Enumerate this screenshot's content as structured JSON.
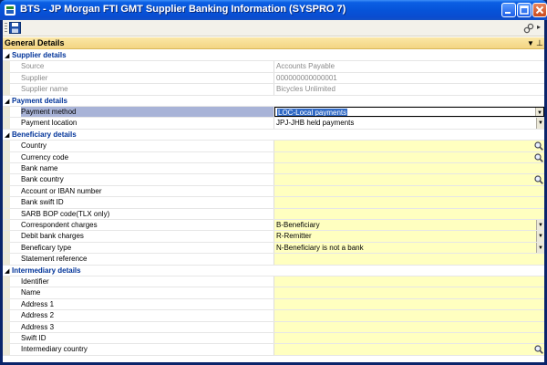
{
  "window": {
    "title": "BTS - JP Morgan FTI GMT Supplier Banking Information (SYSPRO 7)"
  },
  "icons": {
    "app": "app-icon",
    "save": "save-icon",
    "options": "chain-link-icon",
    "lookup": "magnifier-icon"
  },
  "panel": {
    "title": "General Details"
  },
  "groups": {
    "supplier": "Supplier details",
    "payment": "Payment details",
    "beneficiary": "Beneficiary details",
    "intermediary": "Intermediary details"
  },
  "fields": {
    "source": {
      "label": "Source",
      "value": "Accounts Payable"
    },
    "supplier": {
      "label": "Supplier",
      "value": "000000000000001"
    },
    "supplier_name": {
      "label": "Supplier name",
      "value": "Bicycles Unlimited"
    },
    "payment_method": {
      "label": "Payment method",
      "value": "LOC-Local payments"
    },
    "payment_location": {
      "label": "Payment location",
      "value": "JPJ-JHB held payments"
    },
    "country": {
      "label": "Country",
      "value": ""
    },
    "currency_code": {
      "label": "Currency code",
      "value": ""
    },
    "bank_name": {
      "label": "Bank name",
      "value": ""
    },
    "bank_country": {
      "label": "Bank country",
      "value": ""
    },
    "account_iban": {
      "label": "Account or IBAN number",
      "value": ""
    },
    "bank_swift": {
      "label": "Bank swift ID",
      "value": ""
    },
    "sarb_bop": {
      "label": "SARB BOP code(TLX only)",
      "value": ""
    },
    "correspondent_charges": {
      "label": "Correspondent charges",
      "value": "B-Beneficiary"
    },
    "debit_bank_charges": {
      "label": "Debit bank charges",
      "value": "R-Remitter"
    },
    "beneficiary_type": {
      "label": "Beneficary type",
      "value": "N-Beneficiary is not a bank"
    },
    "statement_reference": {
      "label": "Statement reference",
      "value": ""
    },
    "identifier": {
      "label": "Identifier",
      "value": ""
    },
    "name": {
      "label": "Name",
      "value": ""
    },
    "address1": {
      "label": "Address 1",
      "value": ""
    },
    "address2": {
      "label": "Address 2",
      "value": ""
    },
    "address3": {
      "label": "Address 3",
      "value": ""
    },
    "swift_id": {
      "label": "Swift ID",
      "value": ""
    },
    "intermediary_country": {
      "label": "Intermediary country",
      "value": ""
    }
  },
  "colors": {
    "titlebar": "#0654d9",
    "section_header": "#f3d583",
    "required_field": "#ffffc0",
    "group_text": "#003399",
    "selection": "#316ac5"
  }
}
